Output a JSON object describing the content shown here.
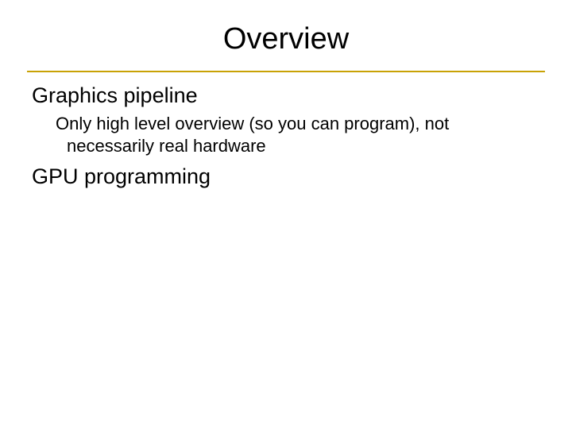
{
  "slide": {
    "title": "Overview",
    "bullets": {
      "pipeline": {
        "heading": "Graphics pipeline",
        "sub": "Only high level overview (so you can program), not necessarily real hardware"
      },
      "gpu": {
        "heading": "GPU programming"
      }
    }
  }
}
